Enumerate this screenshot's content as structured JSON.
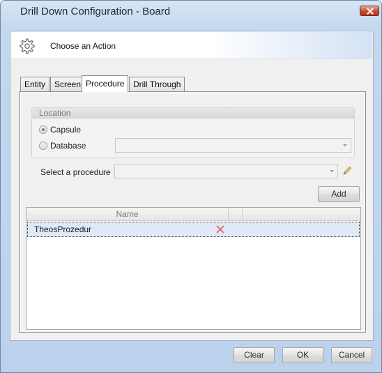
{
  "window": {
    "title": "Drill Down Configuration - Board"
  },
  "banner": {
    "title": "Choose an Action"
  },
  "tabs": [
    {
      "label": "Entity"
    },
    {
      "label": "Screen"
    },
    {
      "label": "Procedure",
      "active": true
    },
    {
      "label": "Drill Through"
    }
  ],
  "location": {
    "header": "Location",
    "options": [
      {
        "label": "Capsule",
        "selected": true
      },
      {
        "label": "Database",
        "selected": false
      }
    ],
    "database_value": ""
  },
  "procedure": {
    "label": "Select a procedure",
    "value": "",
    "add_label": "Add"
  },
  "grid": {
    "columns": [
      "Name",
      ""
    ],
    "rows": [
      {
        "name": "TheosProzedur"
      }
    ]
  },
  "footer": {
    "clear_label": "Clear",
    "ok_label": "OK",
    "cancel_label": "Cancel"
  },
  "colors": {
    "title_bar": "#c4d8ef",
    "close_button": "#c94a30",
    "selected_row": "#dfe9f7",
    "delete_icon": "#e06565"
  },
  "icons": [
    "close-icon",
    "gear-icon",
    "pencil-icon",
    "delete-icon",
    "chevron-down-icon"
  ]
}
